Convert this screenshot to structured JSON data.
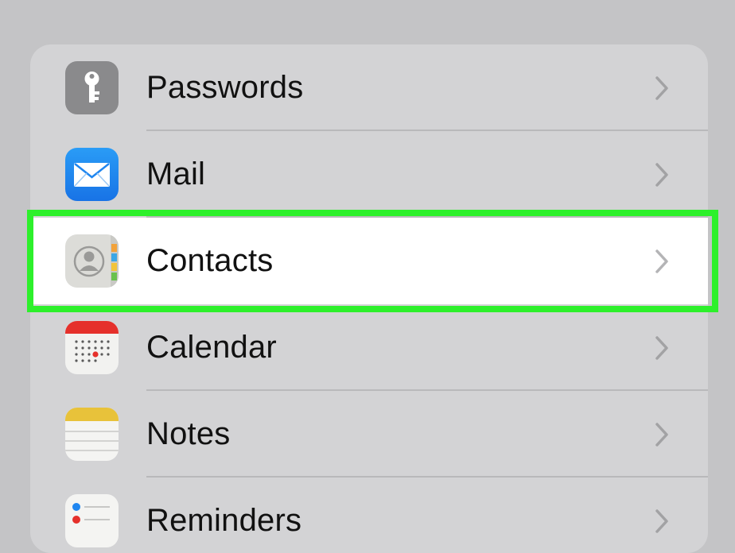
{
  "settings_list": {
    "items": [
      {
        "label": "Passwords",
        "icon": "key-icon"
      },
      {
        "label": "Mail",
        "icon": "envelope-icon"
      },
      {
        "label": "Contacts",
        "icon": "contact-card-icon",
        "selected": true
      },
      {
        "label": "Calendar",
        "icon": "calendar-icon"
      },
      {
        "label": "Notes",
        "icon": "notepad-icon"
      },
      {
        "label": "Reminders",
        "icon": "reminders-icon"
      }
    ]
  },
  "colors": {
    "highlight": "#2df02b",
    "mail_blue": "#1f86f0",
    "calendar_red": "#e5302b",
    "notes_yellow": "#e8c23a"
  }
}
